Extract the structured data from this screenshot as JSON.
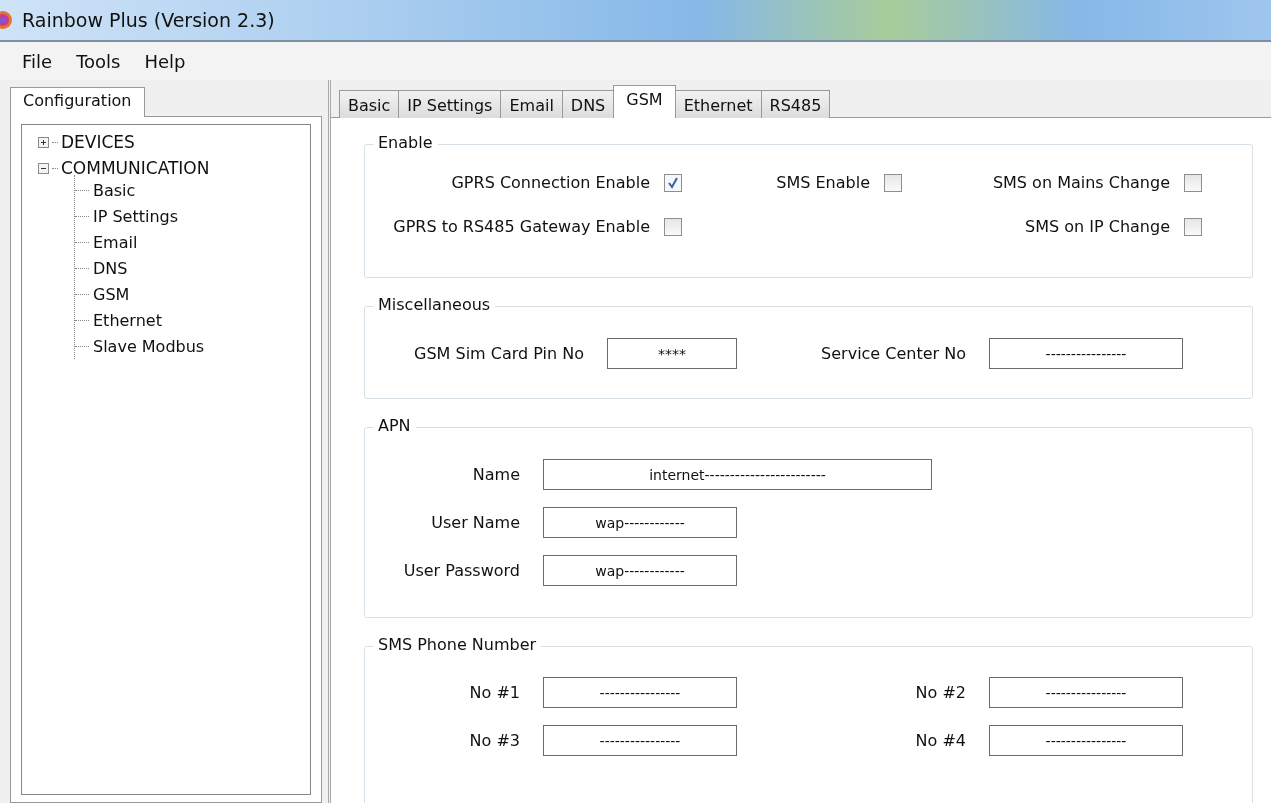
{
  "window": {
    "title": "Rainbow Plus (Version 2.3)"
  },
  "menu": [
    "File",
    "Tools",
    "Help"
  ],
  "left_panel": {
    "tab": {
      "label": "Configuration",
      "selected": true
    },
    "tree": [
      {
        "label": "DEVICES",
        "expanded": false
      },
      {
        "label": "COMMUNICATION",
        "expanded": true,
        "children": [
          {
            "label": "Basic"
          },
          {
            "label": "IP Settings"
          },
          {
            "label": "Email"
          },
          {
            "label": "DNS"
          },
          {
            "label": "GSM"
          },
          {
            "label": "Ethernet"
          },
          {
            "label": "Slave Modbus"
          }
        ]
      }
    ]
  },
  "tabs": [
    {
      "label": "Basic",
      "selected": false
    },
    {
      "label": "IP Settings",
      "selected": false
    },
    {
      "label": "Email",
      "selected": false
    },
    {
      "label": "DNS",
      "selected": false
    },
    {
      "label": "GSM",
      "selected": true
    },
    {
      "label": "Ethernet",
      "selected": false
    },
    {
      "label": "RS485",
      "selected": false
    }
  ],
  "enable": {
    "title": "Enable",
    "rows": [
      [
        {
          "label": "GPRS Connection Enable",
          "checked": true
        },
        {
          "label": "SMS Enable",
          "checked": false
        },
        {
          "label": "SMS on Mains Change",
          "checked": false
        }
      ],
      [
        {
          "label": "GPRS to RS485 Gateway Enable",
          "checked": false
        },
        null,
        {
          "label": "SMS on IP Change",
          "checked": false
        }
      ]
    ]
  },
  "miscellaneous": {
    "title": "Miscellaneous",
    "fields": [
      {
        "label": "GSM Sim Card Pin No",
        "value": "****"
      },
      {
        "label": "Service Center No",
        "value": "----------------"
      }
    ]
  },
  "apn": {
    "title": "APN",
    "fields": [
      {
        "label": "Name",
        "value": "internet------------------------",
        "kind": "wide"
      },
      {
        "label": "User Name",
        "value": "wap------------",
        "kind": "normal"
      },
      {
        "label": "User Password",
        "value": "wap------------",
        "kind": "normal"
      }
    ]
  },
  "sms_phone_number": {
    "title": "SMS Phone Number",
    "fields": [
      {
        "label": "No #1",
        "value": "----------------"
      },
      {
        "label": "No #2",
        "value": "----------------"
      },
      {
        "label": "No #3",
        "value": "----------------"
      },
      {
        "label": "No #4",
        "value": "----------------"
      }
    ]
  }
}
